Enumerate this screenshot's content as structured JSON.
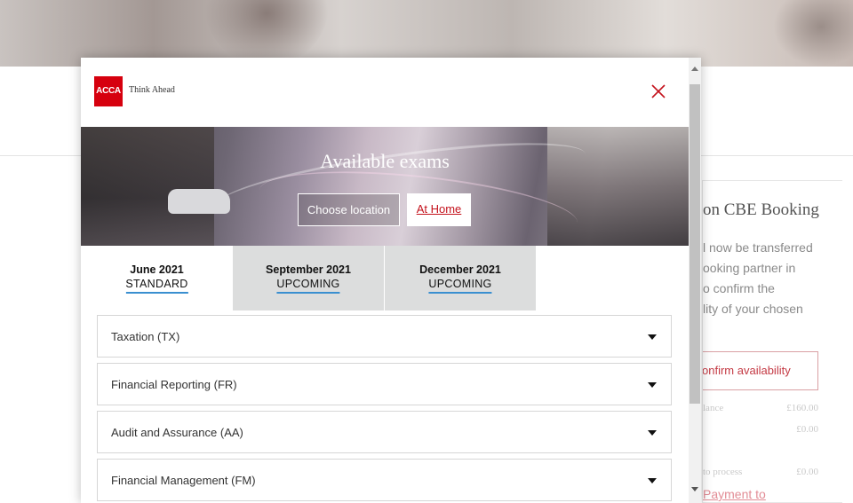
{
  "background": {
    "card": {
      "title": "on CBE Booking",
      "lines": [
        "l now be transferred",
        "ooking partner in",
        "o confirm the",
        "lity of your chosen"
      ],
      "button_label": "onfirm availability",
      "rows": [
        {
          "label": "lance",
          "value": "£160.00"
        },
        {
          "label": "",
          "value": "£0.00"
        },
        {
          "label": "",
          "value": ""
        },
        {
          "label": "to process",
          "value": "£0.00"
        }
      ],
      "link": "Payment to"
    }
  },
  "modal": {
    "logo_text": "ACCA",
    "tagline": "Think Ahead",
    "close_icon": "close-icon",
    "banner_title": "Available exams",
    "location_buttons": [
      {
        "label": "Choose location",
        "selected": false
      },
      {
        "label": "At Home",
        "selected": true
      }
    ],
    "tabs": [
      {
        "period": "June 2021",
        "status": "STANDARD",
        "active": true
      },
      {
        "period": "September 2021",
        "status": "UPCOMING",
        "active": false
      },
      {
        "period": "December 2021",
        "status": "UPCOMING",
        "active": false
      }
    ],
    "exams": [
      {
        "name": "Taxation (TX)"
      },
      {
        "name": "Financial Reporting (FR)"
      },
      {
        "name": "Audit and Assurance (AA)"
      },
      {
        "name": "Financial Management (FM)"
      }
    ]
  },
  "colors": {
    "brand_red": "#d6000e",
    "tab_underline": "#3a8fd0",
    "inactive_tab": "#dcdddd"
  }
}
